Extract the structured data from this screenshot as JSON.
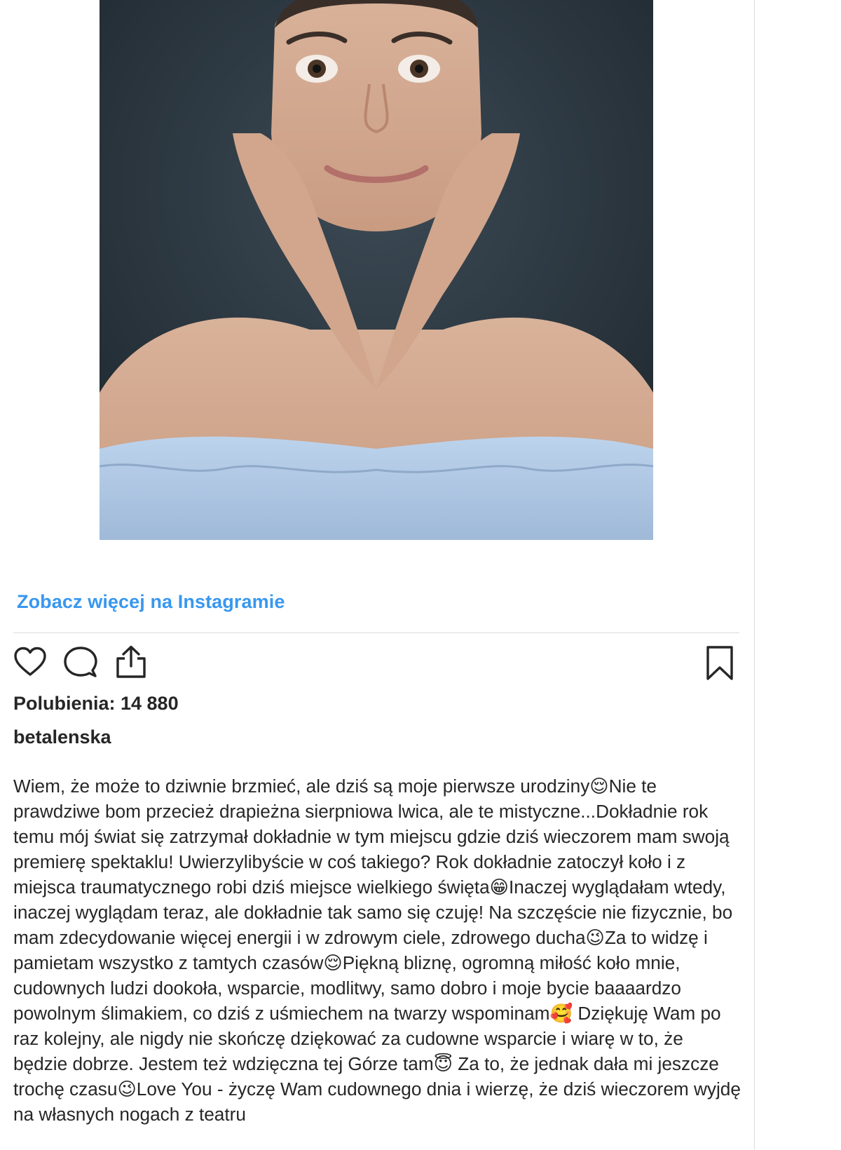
{
  "post": {
    "photo_alt": "",
    "see_more_label": "Zobacz więcej na Instagramie",
    "likes_label": "Polubienia: 14 880",
    "username": "betalenska",
    "caption": "Wiem, że może to dziwnie brzmieć, ale dziś są moje pierwsze urodziny😌Nie te prawdziwe bom przecież drapieżna sierpniowa lwica, ale te mistyczne...Dokładnie rok temu mój świat się zatrzymał dokładnie w tym miejscu gdzie dziś wieczorem mam swoją premierę spektaklu! Uwierzylibyście w coś takiego? Rok dokładnie zatoczył koło i z miejsca traumatycznego robi dziś miejsce wielkiego święta😁Inaczej wyglądałam wtedy, inaczej wyglądam teraz, ale dokładnie tak samo się czuję! Na szczęście nie fizycznie, bo mam zdecydowanie więcej energii i w zdrowym ciele, zdrowego ducha😉Za to widzę i pamietam wszystko z tamtych czasów😌Piękną bliznę, ogromną miłość koło mnie, cudownych ludzi dookoła, wsparcie, modlitwy, samo dobro i moje bycie baaaardzo powolnym ślimakiem, co dziś z uśmiechem na twarzy wspominam🥰 Dziękuję Wam po raz kolejny, ale nigdy nie skończę dziękować za cudowne wsparcie i wiarę w to, że będzie dobrze. Jestem też wdzięczna tej Górze tam😇 Za to, że jednak dała mi jeszcze trochę czasu😉Love You - życzę Wam cudownego dnia i wierzę, że dziś wieczorem wyjdę na własnych nogach z teatru"
  },
  "icons": {
    "like": "heart-icon",
    "comment": "comment-bubble-icon",
    "share": "share-icon",
    "save": "bookmark-icon"
  },
  "colors": {
    "link": "#3897f0",
    "text": "#262626",
    "divider": "#dbdbdb"
  }
}
